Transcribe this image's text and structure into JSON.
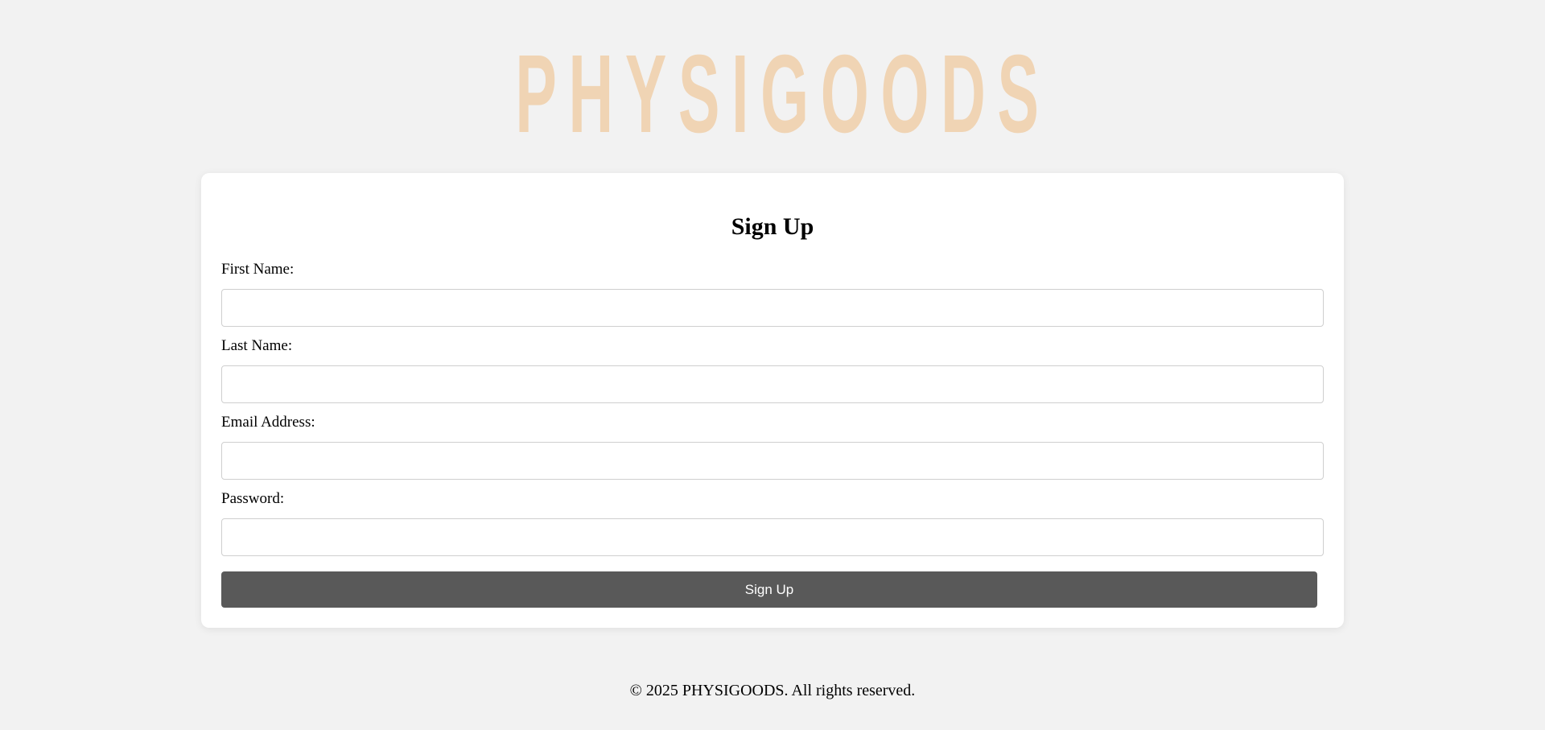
{
  "brand": {
    "logo_text": "PHYSIGOODS",
    "logo_color": "#f0d4b4"
  },
  "form": {
    "title": "Sign Up",
    "fields": [
      {
        "label": "First Name:",
        "value": "",
        "placeholder": ""
      },
      {
        "label": "Last Name:",
        "value": "",
        "placeholder": ""
      },
      {
        "label": "Email Address:",
        "value": "",
        "placeholder": ""
      },
      {
        "label": "Password:",
        "value": "",
        "placeholder": ""
      }
    ],
    "submit_label": "Sign Up",
    "submit_color": "#595959"
  },
  "footer": {
    "text": "© 2025 PHYSIGOODS. All rights reserved."
  },
  "colors": {
    "background": "#f2f2f2",
    "card": "#ffffff"
  }
}
